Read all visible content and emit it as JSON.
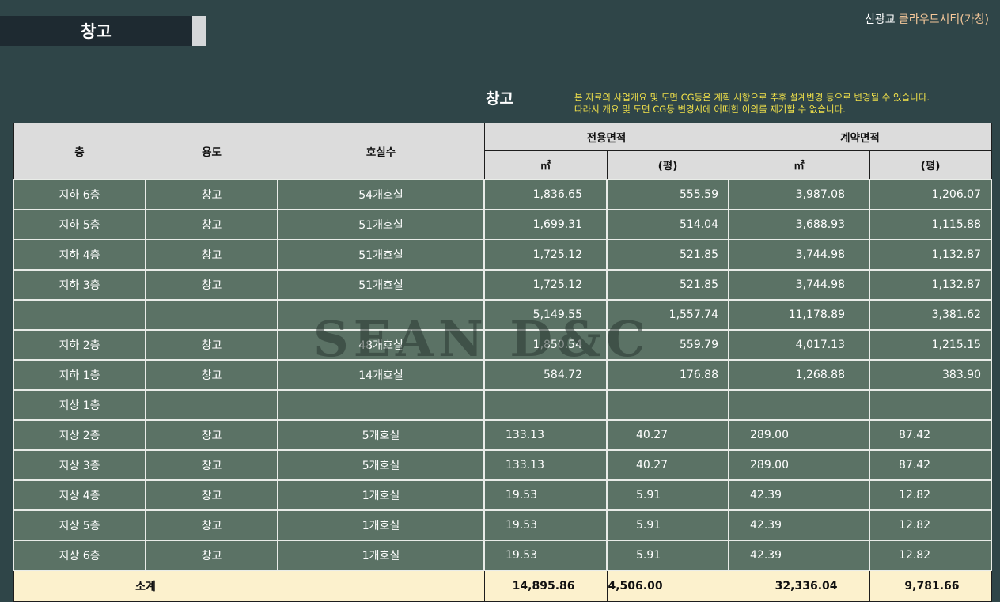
{
  "header": {
    "title": "창고",
    "brand_prefix": "신광교",
    "brand_name": "클라우드시티(가칭)"
  },
  "section": {
    "title": "창고",
    "notice_line1": "본 자료의 사업개요 및 도면 CG등은 계획 사항으로 추후 설계변경 등으로 변경될 수 있습니다.",
    "notice_line2": "따라서 개요 및 도면 CG등 변경시에 어떠한 이의를 제기할 수 없습니다."
  },
  "watermark": "SEAN D&C",
  "colors": {
    "background": "#2f4548",
    "row_fill": "#5b7265",
    "total_fill": "#fcf1cd",
    "notice": "#f1e14a",
    "brand_accent": "#f5c89a"
  },
  "table": {
    "headers": {
      "floor": "층",
      "use": "용도",
      "units": "호실수",
      "exclusive_area": "전용면적",
      "contract_area": "계약면적",
      "unit_m2": "㎡",
      "unit_pyeong": "(평)"
    },
    "rows": [
      {
        "floor": "지하 6층",
        "use": "창고",
        "units": "54개호실",
        "ex_m2": "1,836.65",
        "ex_py": "555.59",
        "ct_m2": "3,987.08",
        "ct_py": "1,206.07"
      },
      {
        "floor": "지하 5층",
        "use": "창고",
        "units": "51개호실",
        "ex_m2": "1,699.31",
        "ex_py": "514.04",
        "ct_m2": "3,688.93",
        "ct_py": "1,115.88"
      },
      {
        "floor": "지하 4층",
        "use": "창고",
        "units": "51개호실",
        "ex_m2": "1,725.12",
        "ex_py": "521.85",
        "ct_m2": "3,744.98",
        "ct_py": "1,132.87"
      },
      {
        "floor": "지하 3층",
        "use": "창고",
        "units": "51개호실",
        "ex_m2": "1,725.12",
        "ex_py": "521.85",
        "ct_m2": "3,744.98",
        "ct_py": "1,132.87"
      },
      {
        "floor": "",
        "use": "",
        "units": "",
        "ex_m2": "5,149.55",
        "ex_py": "1,557.74",
        "ct_m2": "11,178.89",
        "ct_py": "3,381.62"
      },
      {
        "floor": "지하 2층",
        "use": "창고",
        "units": "48개호실",
        "ex_m2": "1,850.54",
        "ex_py": "559.79",
        "ct_m2": "4,017.13",
        "ct_py": "1,215.15"
      },
      {
        "floor": "지하 1층",
        "use": "창고",
        "units": "14개호실",
        "ex_m2": "584.72",
        "ex_py": "176.88",
        "ct_m2": "1,268.88",
        "ct_py": "383.90"
      },
      {
        "floor": "지상 1층",
        "use": "",
        "units": "",
        "ex_m2": "",
        "ex_py": "",
        "ct_m2": "",
        "ct_py": ""
      },
      {
        "floor": "지상 2층",
        "use": "창고",
        "units": "5개호실",
        "ex_m2": "133.13",
        "ex_py": "40.27",
        "ct_m2": "289.00",
        "ct_py": "87.42"
      },
      {
        "floor": "지상 3층",
        "use": "창고",
        "units": "5개호실",
        "ex_m2": "133.13",
        "ex_py": "40.27",
        "ct_m2": "289.00",
        "ct_py": "87.42"
      },
      {
        "floor": "지상 4층",
        "use": "창고",
        "units": "1개호실",
        "ex_m2": "19.53",
        "ex_py": "5.91",
        "ct_m2": "42.39",
        "ct_py": "12.82"
      },
      {
        "floor": "지상 5층",
        "use": "창고",
        "units": "1개호실",
        "ex_m2": "19.53",
        "ex_py": "5.91",
        "ct_m2": "42.39",
        "ct_py": "12.82"
      },
      {
        "floor": "지상 6층",
        "use": "창고",
        "units": "1개호실",
        "ex_m2": "19.53",
        "ex_py": "5.91",
        "ct_m2": "42.39",
        "ct_py": "12.82"
      }
    ],
    "total": {
      "label": "소계",
      "units": "",
      "ex_m2": "14,895.86",
      "ex_py": "4,506.00",
      "ct_m2": "32,336.04",
      "ct_py": "9,781.66"
    }
  }
}
